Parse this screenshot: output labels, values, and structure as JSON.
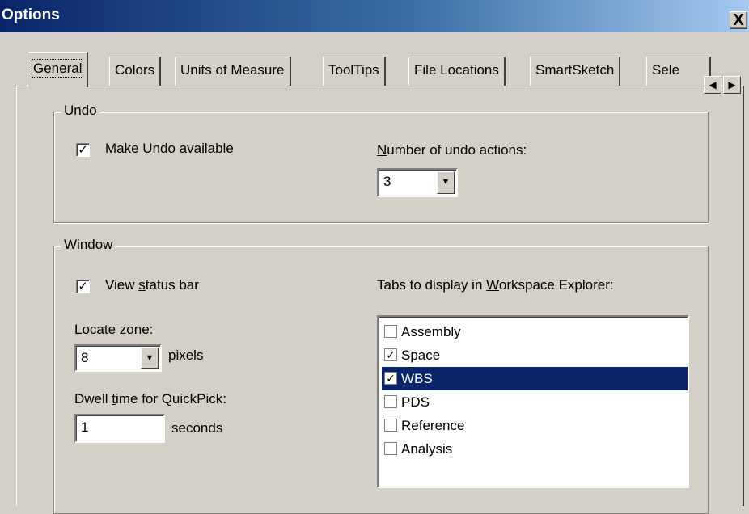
{
  "window": {
    "title": "Options",
    "close_label": "X"
  },
  "tabs": [
    {
      "label": "General"
    },
    {
      "label": "Colors"
    },
    {
      "label": "Units of Measure"
    },
    {
      "label": "ToolTips"
    },
    {
      "label": "File Locations"
    },
    {
      "label": "SmartSketch"
    },
    {
      "label": "Sele"
    }
  ],
  "undo": {
    "group_label": "Undo",
    "make_undo_checked": true,
    "number_label": "Number of undo actions:",
    "number_value": "3"
  },
  "window_group": {
    "group_label": "Window",
    "view_status_bar_checked": true,
    "locate_zone_label": "Locate zone:",
    "locate_zone_value": "8",
    "pixels_label": "pixels",
    "dwell_label": "Dwell time for QuickPick:",
    "dwell_value": "1",
    "seconds_label": "seconds",
    "tabs_label_pre": "Tabs to display in ",
    "tabs_label_u": "W",
    "tabs_label_post": "orkspace Explorer:",
    "workspace_tabs": [
      {
        "label": "Assembly",
        "checked": false,
        "selected": false
      },
      {
        "label": "Space",
        "checked": true,
        "selected": false
      },
      {
        "label": "WBS",
        "checked": true,
        "selected": true
      },
      {
        "label": "PDS",
        "checked": false,
        "selected": false
      },
      {
        "label": "Reference",
        "checked": false,
        "selected": false
      },
      {
        "label": "Analysis",
        "checked": false,
        "selected": false
      }
    ]
  },
  "icons": {
    "check": "✓",
    "combo_arrow": "▼",
    "scroll_left": "◀",
    "scroll_right": "▶"
  },
  "colors": {
    "selection": "#0a246a",
    "title_start": "#0a246a",
    "face": "#d4d0c8"
  }
}
